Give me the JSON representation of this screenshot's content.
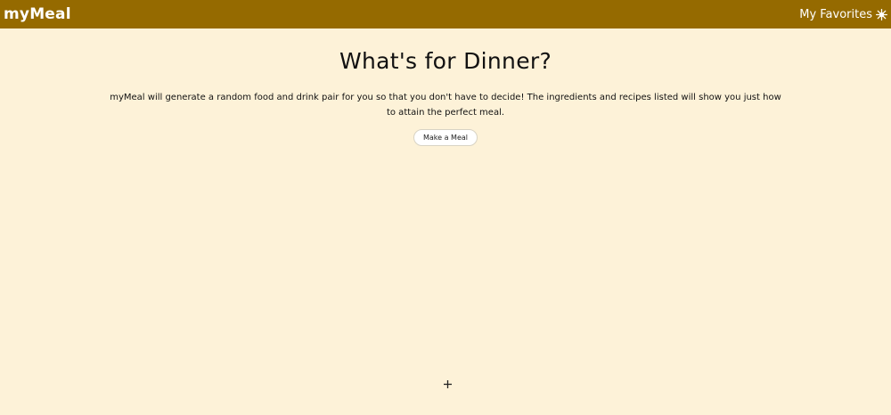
{
  "navbar": {
    "brand": "myMeal",
    "favorites_label": "My Favorites",
    "favorites_icon": "star-icon",
    "bg_color": "#956a00"
  },
  "main": {
    "title": "What's for Dinner?",
    "description": "myMeal will generate a random food and drink pair for you so that you don't have to decide! The ingredients and recipes listed will show you just how to attain the perfect meal.",
    "button_label": "Make a Meal",
    "bg_color": "#fdf2d8"
  },
  "cursor": {
    "icon": "move-cursor-icon"
  }
}
